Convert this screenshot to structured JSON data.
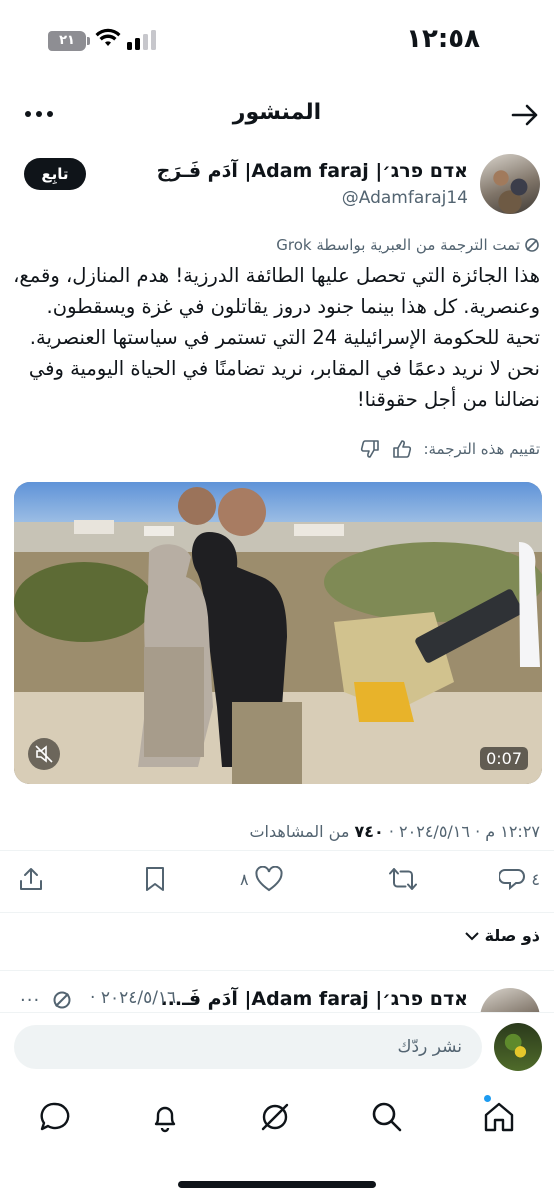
{
  "status": {
    "time": "١٢:٥٨",
    "battery": "٢١",
    "battery_level": 0.21
  },
  "header": {
    "title": "المنشور"
  },
  "post": {
    "author_name": "אדם פרג׳| Adam faraj| آدَم فَـرَج",
    "author_handle": "@Adamfaraj14",
    "follow_label": "تابِع",
    "translated_note": "تمت الترجمة من العبرية بواسطة Grok",
    "text": "هذا الجائزة التي تحصل عليها الطائفة الدرزية! هدم المنازل، وقمع، وعنصرية. كل هذا بينما جنود دروز يقاتلون في غزة ويسقطون. تحية للحكومة الإسرائيلية 24 التي تستمر في سياستها العنصرية. نحن لا نريد دعمًا في المقابر، نريد تضامنًا في الحياة اليومية وفي نضالنا من أجل حقوقنا!",
    "rate_label": "تقييم هذه الترجمة:",
    "video_duration": "0:07",
    "timestamp": "١٢:٢٧ م · ٢٠٢٤/٥/١٦ ·",
    "views_count": "٧٤٠",
    "views_label": "من المشاهدات",
    "replies_count": "٤",
    "likes_count": "٨",
    "related_label": "ذو صلة"
  },
  "next_post": {
    "author_name": "אדם פרג׳| Adam faraj| آدَم فَـ...",
    "date": "٢٠٢٤/٥/١٦ ·",
    "more": "···"
  },
  "reply": {
    "placeholder": "نشر ردّك"
  }
}
